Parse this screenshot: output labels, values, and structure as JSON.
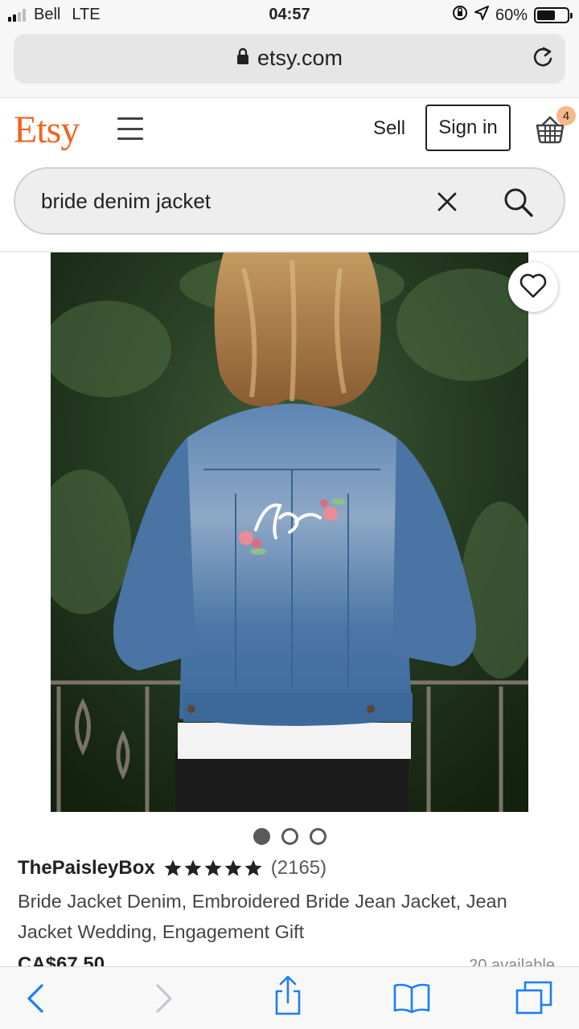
{
  "status_bar": {
    "carrier": "Bell",
    "network": "LTE",
    "time": "04:57",
    "battery_percent": "60%",
    "battery_level": 0.6
  },
  "browser": {
    "url": "etsy.com"
  },
  "header": {
    "logo": "Etsy",
    "sell_label": "Sell",
    "signin_label": "Sign in",
    "cart_count": "4"
  },
  "search": {
    "query": "bride denim jacket"
  },
  "listing": {
    "image_index": 1,
    "image_count": 3,
    "shop_name": "ThePaisleyBox",
    "rating_stars": 5,
    "review_count": "(2165)",
    "title": "Bride Jacket Denim, Embroidered Bride Jean Jacket, Jean Jacket Wedding, Engagement Gift",
    "price": "CA$67.50",
    "availability": "20 available"
  },
  "icons": {
    "lock": "lock-icon",
    "reload": "reload-icon",
    "menu": "hamburger-icon",
    "cart": "basket-icon",
    "clear": "close-icon",
    "search": "search-icon",
    "favorite": "heart-icon",
    "back": "chevron-left-icon",
    "forward": "chevron-right-icon",
    "share": "share-icon",
    "bookmarks": "book-icon",
    "tabs": "tabs-icon"
  },
  "colors": {
    "brand": "#f1641e",
    "ios_blue": "#1a7ef5"
  }
}
